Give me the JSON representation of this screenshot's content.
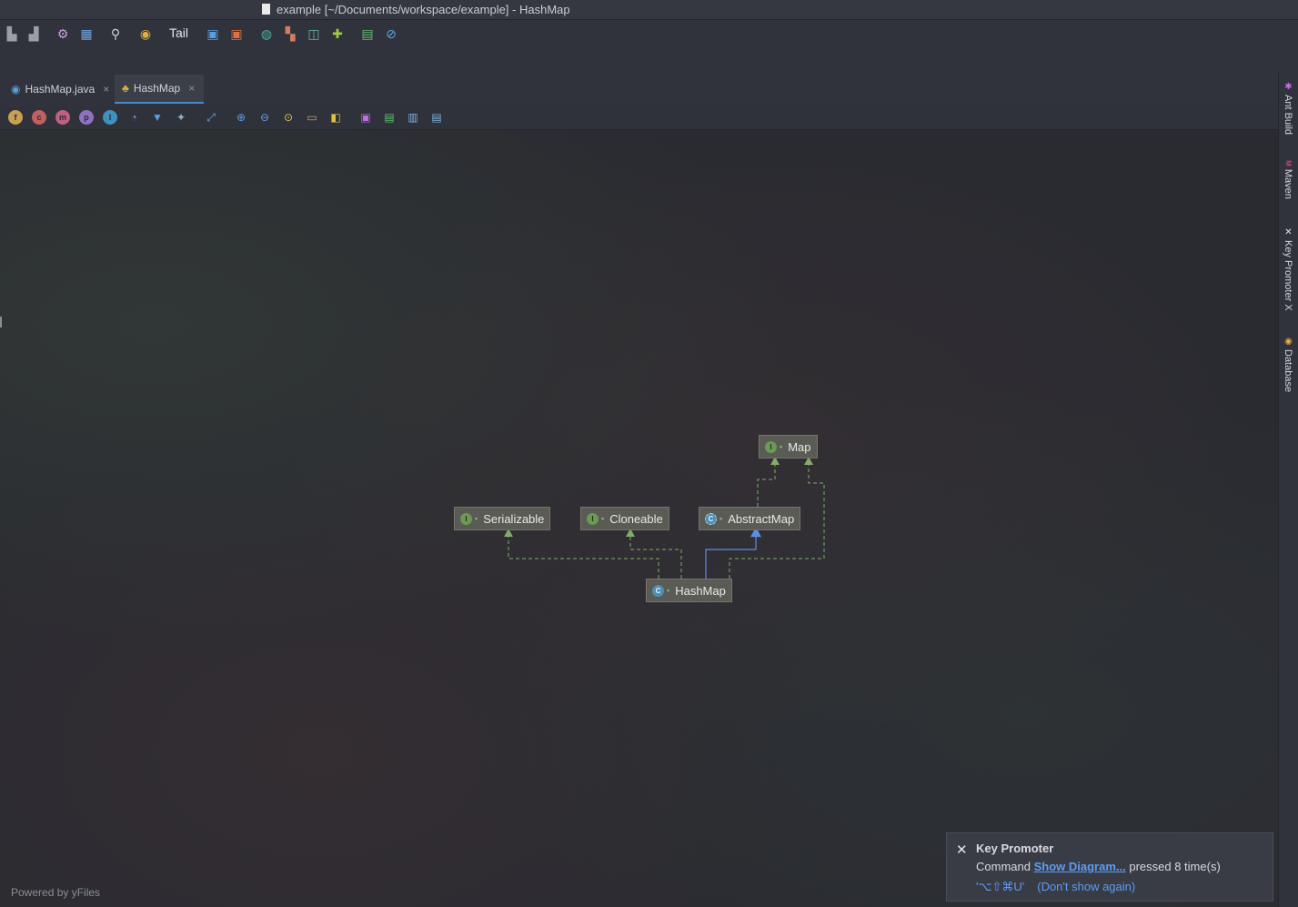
{
  "window": {
    "title": "example [~/Documents/workspace/example] - HashMap"
  },
  "toolbar": {
    "tail_label": "Tail",
    "icons": [
      "build-icon",
      "rebuild-icon",
      "settings-icon",
      "structure-icon",
      "search-icon",
      "plugin-icon",
      "translate-icon",
      "office-icon",
      "coverage-icon",
      "palette-icon",
      "inspect-icon",
      "puzzle-icon",
      "monitor-icon",
      "no-entry-icon"
    ]
  },
  "tabs": [
    {
      "label": "HashMap.java",
      "icon": "java-class-icon",
      "close": "×",
      "active": false
    },
    {
      "label": "HashMap",
      "icon": "diagram-icon",
      "close": "×",
      "active": true
    }
  ],
  "diagram_toolbar": {
    "icons": [
      "fields-icon",
      "constructors-icon",
      "methods-icon",
      "properties-icon",
      "inner-classes-icon",
      "change-visibility-icon",
      "filter-icon",
      "pin-icon",
      "layout-icon",
      "zoom-in-icon",
      "zoom-out-icon",
      "actual-size-icon",
      "fit-content-icon",
      "export-icon",
      "save-icon",
      "export-file-icon",
      "print-icon",
      "print-preview-icon"
    ],
    "letters": [
      "f",
      "c",
      "m",
      "p",
      "I"
    ]
  },
  "diagram": {
    "nodes": [
      {
        "id": "map",
        "label": "Map",
        "kind": "interface",
        "kind_letter": "I"
      },
      {
        "id": "serializable",
        "label": "Serializable",
        "kind": "interface",
        "kind_letter": "I"
      },
      {
        "id": "cloneable",
        "label": "Cloneable",
        "kind": "interface",
        "kind_letter": "I"
      },
      {
        "id": "abstractmap",
        "label": "AbstractMap",
        "kind": "abstract-class",
        "kind_letter": "C"
      },
      {
        "id": "hashmap",
        "label": "HashMap",
        "kind": "class",
        "kind_letter": "C"
      }
    ],
    "edges": [
      {
        "from": "hashmap",
        "to": "serializable",
        "type": "implements"
      },
      {
        "from": "hashmap",
        "to": "cloneable",
        "type": "implements"
      },
      {
        "from": "hashmap",
        "to": "abstractmap",
        "type": "extends"
      },
      {
        "from": "hashmap",
        "to": "map",
        "type": "implements"
      },
      {
        "from": "abstractmap",
        "to": "map",
        "type": "implements"
      }
    ],
    "colors": {
      "implements": "#7fae6a",
      "extends": "#5b8fe6",
      "node_bg": "#5b5b56"
    }
  },
  "footer": {
    "powered_by": "Powered by yFiles"
  },
  "sidebar": {
    "tabs": [
      {
        "label": "Ant Build",
        "icon": "ant-icon"
      },
      {
        "label": "Maven",
        "icon": "maven-icon"
      },
      {
        "label": "Key Promoter X",
        "icon": "key-promoter-icon"
      },
      {
        "label": "Database",
        "icon": "database-icon"
      }
    ]
  },
  "notification": {
    "title": "Key Promoter",
    "prefix": "Command",
    "link": "Show Diagram...",
    "suffix": "pressed 8 time(s)",
    "shortcut": "'⌥⇧⌘U'",
    "dismiss": "(Don't show again)"
  }
}
